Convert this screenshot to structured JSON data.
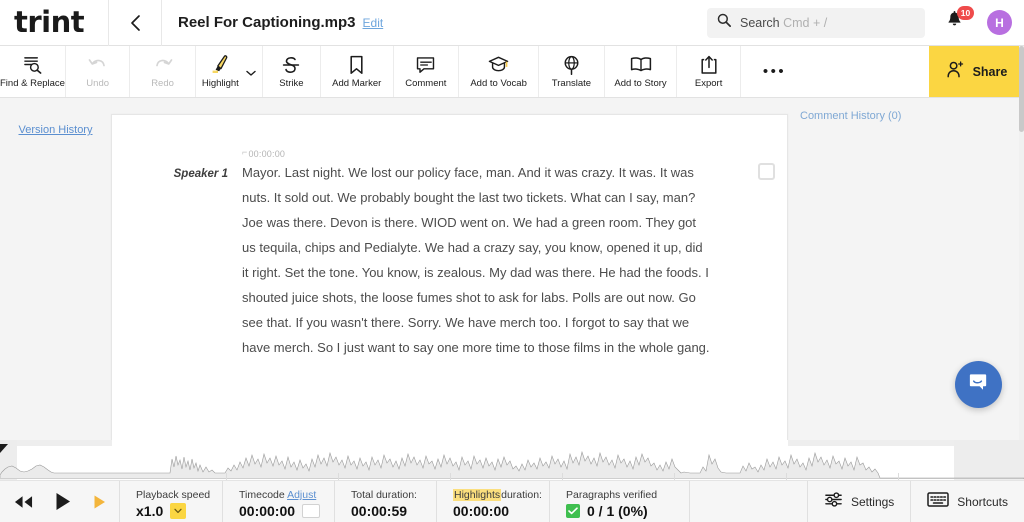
{
  "header": {
    "logo": "trint",
    "back_icon": "chevron-left-icon",
    "doc_title": "Reel For Captioning.mp3",
    "edit_label": "Edit",
    "search": {
      "icon": "search-icon",
      "label": "Search",
      "shortcut": "Cmd + /",
      "placeholder": "Search Cmd + /"
    },
    "notifications": {
      "icon": "bell-icon",
      "count": "10"
    },
    "avatar": {
      "initial": "H",
      "color": "#b86fe0"
    }
  },
  "toolbar": {
    "items": [
      {
        "label": "Find & Replace",
        "icon": "find-replace-icon",
        "disabled": false
      },
      {
        "label": "Undo",
        "icon": "undo-icon",
        "disabled": true
      },
      {
        "label": "Redo",
        "icon": "redo-icon",
        "disabled": true
      },
      {
        "label": "Highlight",
        "icon": "highlighter-icon",
        "disabled": false
      },
      {
        "label": "Strike",
        "icon": "strikethrough-icon",
        "disabled": false
      },
      {
        "label": "Add Marker",
        "icon": "bookmark-icon",
        "disabled": false
      },
      {
        "label": "Comment",
        "icon": "comment-icon",
        "disabled": false
      },
      {
        "label": "Add to Vocab",
        "icon": "graduation-cap-icon",
        "disabled": false
      },
      {
        "label": "Translate",
        "icon": "globe-icon",
        "disabled": false
      },
      {
        "label": "Add to Story",
        "icon": "book-icon",
        "disabled": false
      },
      {
        "label": "Export",
        "icon": "export-icon",
        "disabled": false
      }
    ],
    "more_icon": "ellipsis-icon",
    "share": {
      "label": "Share",
      "icon": "add-person-icon",
      "color": "#fbd642"
    }
  },
  "left_pane": {
    "version_history": "Version History"
  },
  "document": {
    "paragraphs": [
      {
        "speaker": "Speaker 1",
        "timecode": "00:00:00",
        "text": "Mayor. Last night. We lost our policy face, man. And it was crazy. It was. It was nuts. It sold out. We probably bought the last two tickets. What can I say, man? Joe was there. Devon is there. WIOD went on. We had a green room. They got us tequila, chips and Pedialyte. We had a crazy say, you know, opened it up, did it right. Set the tone. You know, is zealous. My dad was there. He had the foods. I shouted juice shots, the loose fumes shot to ask for labs. Polls are out now. Go see that. If you wasn't there. Sorry. We have merch too. I forgot to say that we have merch. So I just want to say one more time to those films in the whole gang."
      }
    ]
  },
  "right_pane": {
    "comment_history": "Comment History (0)",
    "chat_icon": "chat-bubble-icon"
  },
  "player": {
    "controls": {
      "rewind_icon": "rewind-icon",
      "play_icon": "play-icon",
      "forward_icon": "fast-forward-icon"
    },
    "playback_speed": {
      "label": "Playback speed",
      "value": "x1.0",
      "dropdown_icon": "chevron-down-icon"
    },
    "timecode": {
      "label": "Timecode",
      "adjust_label": "Adjust",
      "value": "00:00:00"
    },
    "total_duration": {
      "label": "Total duration:",
      "value": "00:00:59"
    },
    "highlights_duration": {
      "label_highlight": "Highlights",
      "label_rest": "duration:",
      "value": "00:00:00"
    },
    "paragraphs_verified": {
      "label": "Paragraphs verified",
      "value": "0 / 1 (0%)",
      "check_icon": "checkmark-icon"
    },
    "settings": {
      "label": "Settings",
      "icon": "sliders-icon"
    },
    "shortcuts": {
      "label": "Shortcuts",
      "icon": "keyboard-icon"
    }
  }
}
